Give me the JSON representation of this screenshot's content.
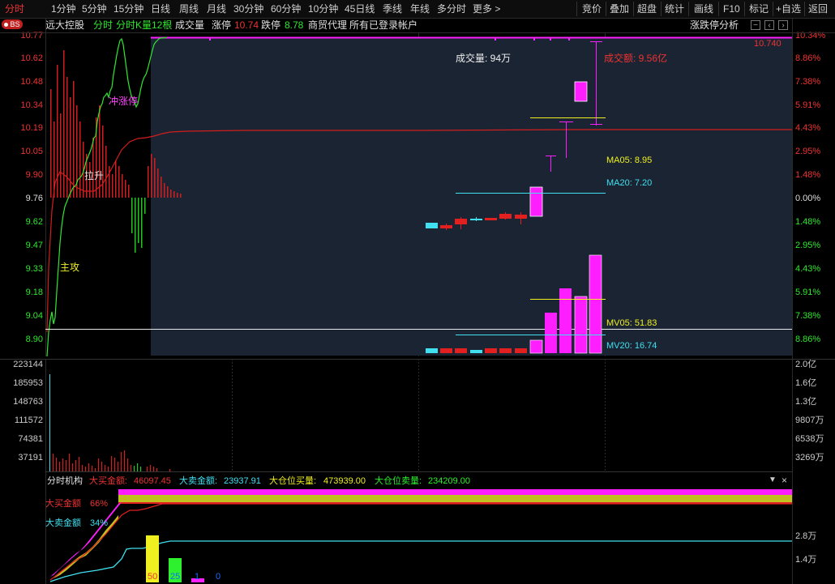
{
  "top_tabs": [
    "分时",
    "1分钟",
    "5分钟",
    "15分钟",
    "日线",
    "周线",
    "月线",
    "30分钟",
    "60分钟",
    "10分钟",
    "45日线",
    "季线",
    "年线",
    "多分时",
    "更多 >"
  ],
  "right_tabs": [
    "竞价",
    "叠加",
    "超盘",
    "统计",
    "画线",
    "F10",
    "标记",
    "+自选",
    "返回"
  ],
  "bs_badge": "BS",
  "info": {
    "name": "远大控股",
    "mode": "分时",
    "kline": "分时K量12根",
    "volume_label": "成交量",
    "limit_up_label": "涨停",
    "limit_up_value": "10.74",
    "limit_down_label": "跌停",
    "limit_down_value": "8.78",
    "industry": "商贸代理",
    "account": "所有已登录帐户",
    "limit_analysis": "涨跌停分析"
  },
  "price_axis": [
    "10.77",
    "10.62",
    "10.48",
    "10.34",
    "10.19",
    "10.05",
    "9.90",
    "9.76",
    "9.62",
    "9.47",
    "9.33",
    "9.18",
    "9.04",
    "8.90"
  ],
  "pct_axis": [
    "10.34%",
    "8.86%",
    "7.38%",
    "5.91%",
    "4.43%",
    "2.95%",
    "1.48%",
    "0.00%",
    "1.48%",
    "2.95%",
    "4.43%",
    "5.91%",
    "7.38%",
    "8.86%"
  ],
  "limit_price_label": "10.740",
  "annotations": {
    "chong_zhang_ting": "冲涨停",
    "la_sheng": "拉升",
    "zhu_gong": "主攻",
    "chengjiao_liang": "成交量: 94万",
    "chengjiao_e": "成交额: 9.56亿",
    "ma05": "MA05: 8.95",
    "ma20": "MA20: 7.20",
    "mv05": "MV05: 51.83",
    "mv20": "MV20: 16.74"
  },
  "vol_axis_left": [
    "223144",
    "185953",
    "148763",
    "111572",
    "74381",
    "37191"
  ],
  "vol_axis_right": [
    "2.0亿",
    "1.6亿",
    "1.3亿",
    "9807万",
    "6538万",
    "3269万"
  ],
  "bottom_panel": {
    "title": "分时机构",
    "big_buy_label": "大买金额:",
    "big_buy_value": "46097.45",
    "big_sell_label": "大卖金额:",
    "big_sell_value": "23937.91",
    "big_pos_buy_label": "大仓位买量:",
    "big_pos_buy_value": "473939.00",
    "big_pos_sell_label": "大仓位卖量:",
    "big_pos_sell_value": "234209.00",
    "buy_pct_label": "大买金额",
    "buy_pct": "66%",
    "sell_pct_label": "大卖金额",
    "sell_pct": "34%",
    "axis_right": [
      "2.8万",
      "1.4万"
    ],
    "bar_50": "50",
    "bar_25": "25",
    "bar_small": "1",
    "bar_small2": "0"
  },
  "colors": {
    "up": "#e32020",
    "down": "#1ec81e",
    "magenta": "#ff1eff",
    "cyan": "#40e0f0",
    "yellow": "#f0f020"
  }
}
